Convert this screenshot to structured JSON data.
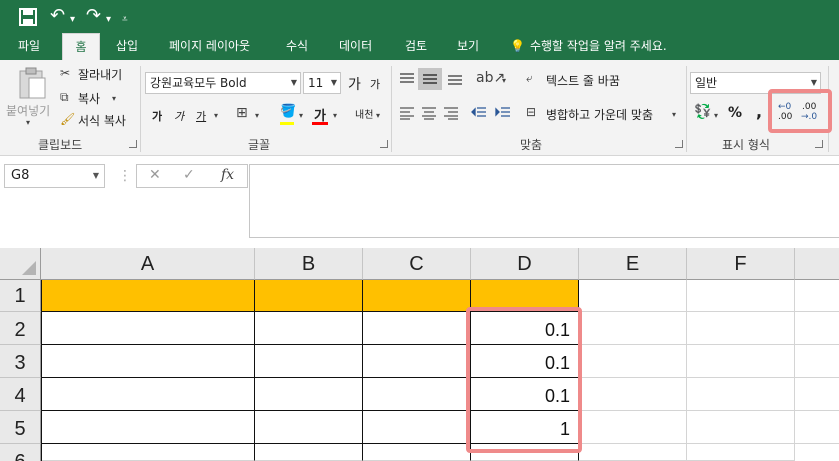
{
  "qat": {
    "save_icon": "save-icon",
    "undo_icon": "undo-icon",
    "redo_icon": "redo-icon",
    "customize_icon": "customize-icon"
  },
  "tabs": [
    "파일",
    "홈",
    "삽입",
    "페이지 레이아웃",
    "수식",
    "데이터",
    "검토",
    "보기"
  ],
  "tell_me": "수행할 작업을 알려 주세요.",
  "clipboard": {
    "paste": "붙여넣기",
    "cut": "잘라내기",
    "copy": "복사",
    "format_painter": "서식 복사",
    "group": "클립보드"
  },
  "font": {
    "name": "강원교육모두 Bold",
    "size": "11",
    "grow": "가",
    "shrink": "가",
    "bold": "가",
    "italic": "가",
    "underline": "가",
    "font_color_glyph": "가",
    "phonetic": "내천",
    "group": "글꼴",
    "highlight_color": "#ffff00",
    "font_color": "#ff0000"
  },
  "alignment": {
    "wrap_text": "텍스트 줄 바꿈",
    "merge_center": "병합하고 가운데 맞춤",
    "group": "맞춤"
  },
  "number": {
    "format": "일반",
    "percent": "%",
    "comma": ",",
    "increase_decimal_top": "←0",
    "increase_decimal_bottom": ".00",
    "decrease_decimal_top": ".00",
    "decrease_decimal_bottom": "→.0",
    "group": "표시 형식"
  },
  "formula_bar": {
    "name_box": "G8",
    "cancel": "✕",
    "enter": "✓",
    "fx": "fx",
    "value": ""
  },
  "grid": {
    "columns": [
      "A",
      "B",
      "C",
      "D",
      "E",
      "F"
    ],
    "rows": [
      "1",
      "2",
      "3",
      "4",
      "5",
      "6"
    ],
    "d_values": [
      "",
      "0.1",
      "0.1",
      "0.1",
      "1"
    ],
    "header_fill": "#ffc000",
    "highlight_color": "#ef8a8a"
  }
}
